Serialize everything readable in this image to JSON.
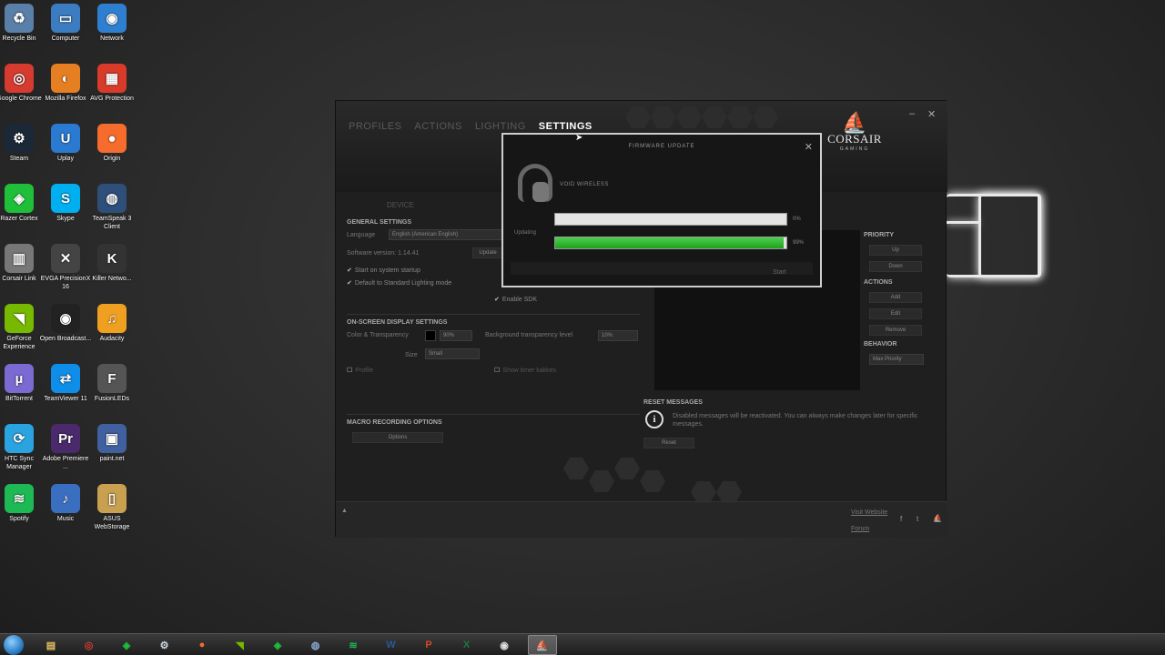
{
  "desktop_icons": [
    {
      "name": "recycle-bin-icon",
      "label": "Recycle Bin",
      "glyph": "♻",
      "color": "#5a7fa8"
    },
    {
      "name": "computer-icon",
      "label": "Computer",
      "glyph": "▭",
      "color": "#3c7cc0"
    },
    {
      "name": "network-icon",
      "label": "Network",
      "glyph": "◉",
      "color": "#2f7fd0"
    },
    {
      "name": "chrome-icon",
      "label": "Google Chrome",
      "glyph": "◎",
      "color": "#d63b2f"
    },
    {
      "name": "firefox-icon",
      "label": "Mozilla Firefox",
      "glyph": "◐",
      "color": "#e67e22"
    },
    {
      "name": "avg-icon",
      "label": "AVG Protection",
      "glyph": "▦",
      "color": "#d93b2b"
    },
    {
      "name": "steam-icon",
      "label": "Steam",
      "glyph": "⚙",
      "color": "#1b2838"
    },
    {
      "name": "uplay-icon",
      "label": "Uplay",
      "glyph": "U",
      "color": "#2a7ad1"
    },
    {
      "name": "origin-icon",
      "label": "Origin",
      "glyph": "●",
      "color": "#f56c2d"
    },
    {
      "name": "razer-cortex-icon",
      "label": "Razer Cortex",
      "glyph": "◈",
      "color": "#1fbf3a"
    },
    {
      "name": "skype-icon",
      "label": "Skype",
      "glyph": "S",
      "color": "#00aff0"
    },
    {
      "name": "teamspeak-icon",
      "label": "TeamSpeak 3 Client",
      "glyph": "◍",
      "color": "#2e4f7a"
    },
    {
      "name": "corsair-link-icon",
      "label": "Corsair Link",
      "glyph": "▥",
      "color": "#777777"
    },
    {
      "name": "evga-icon",
      "label": "EVGA PrecisionX 16",
      "glyph": "✕",
      "color": "#444444"
    },
    {
      "name": "killer-network-icon",
      "label": "Killer Netwo...",
      "glyph": "K",
      "color": "#333333"
    },
    {
      "name": "geforce-icon",
      "label": "GeForce Experience",
      "glyph": "◥",
      "color": "#76b900"
    },
    {
      "name": "obs-icon",
      "label": "Open Broadcast...",
      "glyph": "◉",
      "color": "#222222"
    },
    {
      "name": "audacity-icon",
      "label": "Audacity",
      "glyph": "♫",
      "color": "#f0a020"
    },
    {
      "name": "bittorrent-icon",
      "label": "BitTorrent",
      "glyph": "µ",
      "color": "#7a6ad1"
    },
    {
      "name": "teamviewer-icon",
      "label": "TeamViewer 11",
      "glyph": "⇄",
      "color": "#0e8ee9"
    },
    {
      "name": "fusionleds-icon",
      "label": "FusionLEDs",
      "glyph": "F",
      "color": "#555555"
    },
    {
      "name": "htc-sync-icon",
      "label": "HTC Sync Manager",
      "glyph": "⟳",
      "color": "#2aa4e0"
    },
    {
      "name": "premiere-icon",
      "label": "Adobe Premiere ...",
      "glyph": "Pr",
      "color": "#4a2a6a"
    },
    {
      "name": "paintnet-icon",
      "label": "paint.net",
      "glyph": "▣",
      "color": "#4060a0"
    },
    {
      "name": "spotify-icon",
      "label": "Spotify",
      "glyph": "≋",
      "color": "#1db954"
    },
    {
      "name": "music-icon",
      "label": "Music",
      "glyph": "♪",
      "color": "#3a6fc0"
    },
    {
      "name": "asus-webstorage-icon",
      "label": "ASUS WebStorage",
      "glyph": "▯",
      "color": "#c8a050"
    }
  ],
  "app": {
    "nav": [
      "PROFILES",
      "ACTIONS",
      "LIGHTING",
      "SETTINGS"
    ],
    "active_nav": "SETTINGS",
    "brand_name": "CORSAIR",
    "brand_sub": "GAMING",
    "minimize": "–",
    "close": "✕",
    "device_tab": "DEVICE",
    "general_settings": "GENERAL SETTINGS",
    "language_label": "Language",
    "language_value": "English (American English)",
    "software_version": "Software version: 1.14.41",
    "update_btn": "Update",
    "start_on_startup": "Start on system startup",
    "default_lighting": "Default to Standard Lighting mode",
    "enable_sdk": "Enable SDK",
    "osd_settings": "ON-SCREEN DISPLAY SETTINGS",
    "color_transparency": "Color & Transparency",
    "osd_pct": "90%",
    "bg_transparency_label": "Background transparency level",
    "bg_transparency_value": "10%",
    "size_label": "Size",
    "size_value": "Small",
    "profile_label": "Profile",
    "show_timer": "Show timer kakkes",
    "macro_options": "MACRO RECORDING OPTIONS",
    "options_btn": "Options",
    "priority": "PRIORITY",
    "up": "Up",
    "down": "Down",
    "actions": "ACTIONS",
    "add": "Add",
    "edit": "Edit",
    "remove": "Remove",
    "behavior": "BEHAVIOR",
    "behavior_value": "Max Priority",
    "reset_messages": "RESET MESSAGES",
    "reset_text": "Disabled messages will be reactivated. You can always make changes later for specific messages.",
    "reset_btn": "Reset",
    "footer_link1": "Visit Website",
    "footer_link2": "Forum"
  },
  "dialog": {
    "title": "FIRMWARE UPDATE",
    "close": "✕",
    "device": "VOID WIRELESS",
    "updating_label": "Updating",
    "bar1_pct_text": "0%",
    "bar1_fraction": 0.0,
    "bar2_pct_text": "99%",
    "bar2_fraction": 0.99,
    "ok_btn": "Start"
  },
  "taskbar": [
    {
      "name": "taskbar-explorer",
      "glyph": "▤",
      "color": "#e8c060"
    },
    {
      "name": "taskbar-chrome",
      "glyph": "◎",
      "color": "#d63b2f"
    },
    {
      "name": "taskbar-razer",
      "glyph": "◈",
      "color": "#1fbf3a"
    },
    {
      "name": "taskbar-steam",
      "glyph": "⚙",
      "color": "#cfd8e0"
    },
    {
      "name": "taskbar-origin",
      "glyph": "●",
      "color": "#f56c2d"
    },
    {
      "name": "taskbar-geforce",
      "glyph": "◥",
      "color": "#76b900"
    },
    {
      "name": "taskbar-razer2",
      "glyph": "◈",
      "color": "#1fbf3a"
    },
    {
      "name": "taskbar-teamspeak",
      "glyph": "◍",
      "color": "#8aa8d0"
    },
    {
      "name": "taskbar-spotify",
      "glyph": "≋",
      "color": "#1db954"
    },
    {
      "name": "taskbar-word",
      "glyph": "W",
      "color": "#2b579a"
    },
    {
      "name": "taskbar-powerpoint",
      "glyph": "P",
      "color": "#d24726"
    },
    {
      "name": "taskbar-excel",
      "glyph": "X",
      "color": "#217346"
    },
    {
      "name": "taskbar-obs",
      "glyph": "◉",
      "color": "#dddddd"
    },
    {
      "name": "taskbar-corsair",
      "glyph": "⛵",
      "color": "#ffffff"
    }
  ]
}
